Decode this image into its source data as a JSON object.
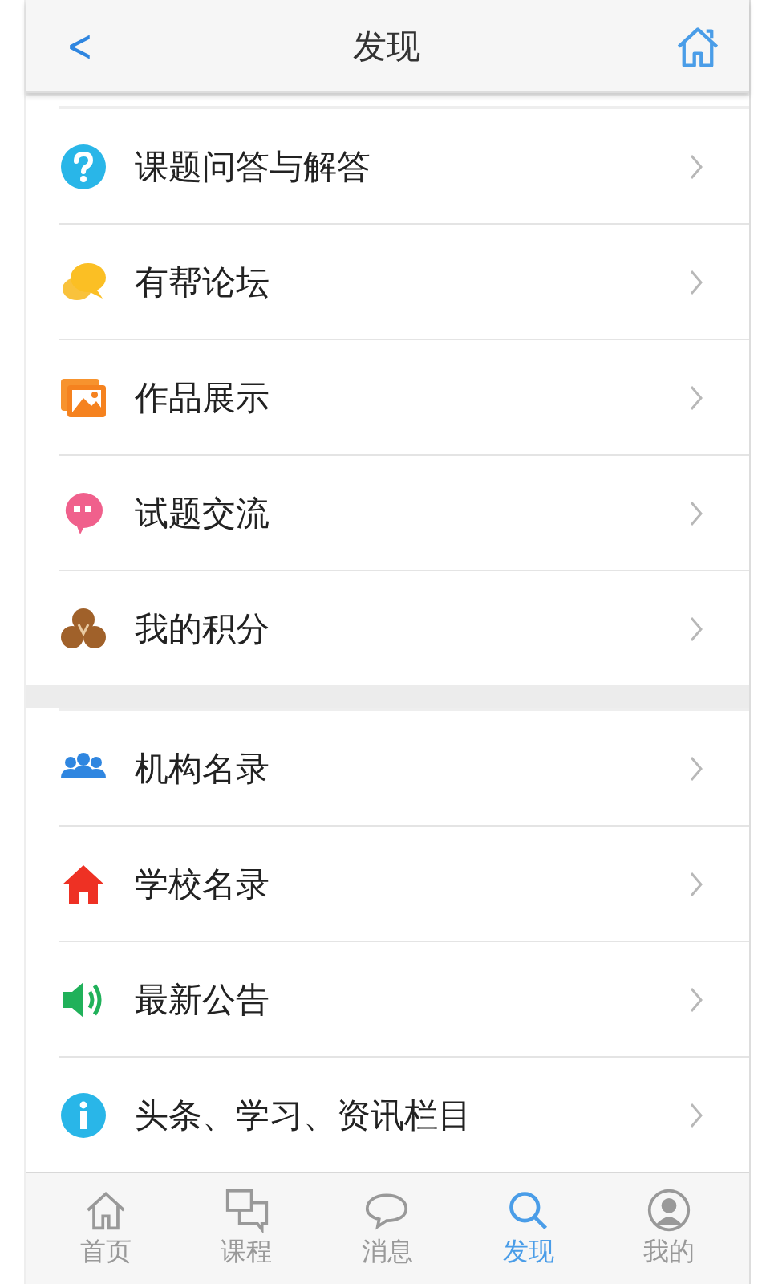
{
  "header": {
    "back": "<",
    "title": "发现"
  },
  "groups": [
    {
      "items": [
        {
          "kind": "question",
          "label": "课题问答与解答"
        },
        {
          "kind": "chat",
          "label": "有帮论坛"
        },
        {
          "kind": "picture",
          "label": "作品展示"
        },
        {
          "kind": "quote",
          "label": "试题交流"
        },
        {
          "kind": "points",
          "label": "我的积分"
        }
      ]
    },
    {
      "items": [
        {
          "kind": "people",
          "label": "机构名录"
        },
        {
          "kind": "house",
          "label": "学校名录"
        },
        {
          "kind": "speaker",
          "label": "最新公告"
        },
        {
          "kind": "info",
          "label": "头条、学习、资讯栏目"
        }
      ]
    }
  ],
  "tabs": [
    {
      "kind": "home",
      "label": "首页",
      "selected": false
    },
    {
      "kind": "windows",
      "label": "课程",
      "selected": false
    },
    {
      "kind": "bubble",
      "label": "消息",
      "selected": false
    },
    {
      "kind": "search",
      "label": "发现",
      "selected": true
    },
    {
      "kind": "user",
      "label": "我的",
      "selected": false
    }
  ]
}
